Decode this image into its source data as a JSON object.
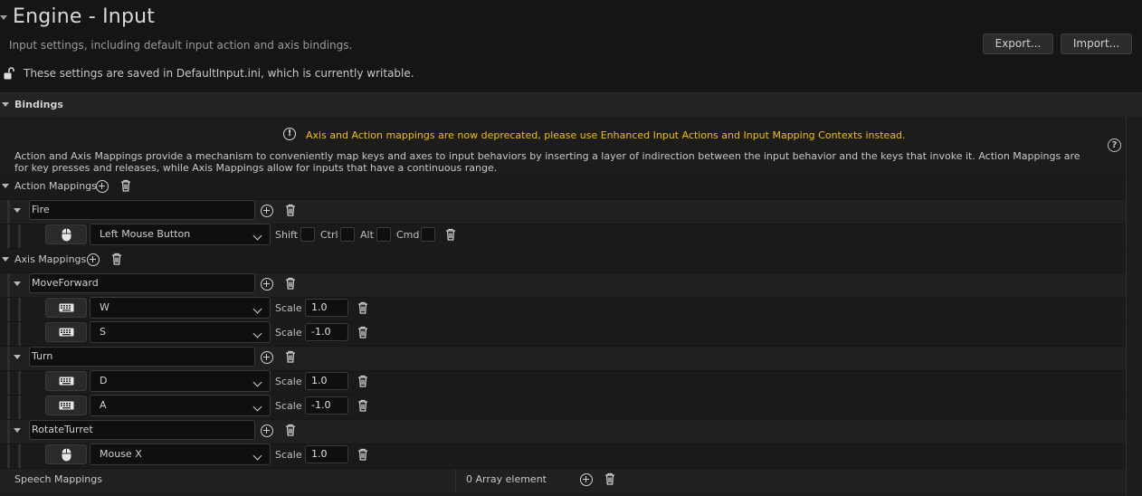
{
  "header": {
    "title": "Engine - Input",
    "subtitle": "Input settings, including default input action and axis bindings.",
    "export_label": "Export...",
    "import_label": "Import...",
    "saved_note": "These settings are saved in DefaultInput.ini, which is currently writable."
  },
  "bindings": {
    "section_label": "Bindings",
    "warning": "Axis and Action mappings are now deprecated, please use Enhanced Input Actions and Input Mapping Contexts instead.",
    "description": "Action and Axis Mappings provide a mechanism to conveniently map keys and axes to input behaviors by inserting a layer of indirection between the input behavior and the keys that invoke it. Action Mappings are for key presses and releases, while Axis Mappings allow for inputs that have a continuous range.",
    "warning_color": "#f0c000"
  },
  "action_mappings": {
    "label": "Action Mappings",
    "items": [
      {
        "name": "Fire",
        "key": "Left Mouse Button",
        "key_icon": "mouse-icon",
        "modifiers": {
          "shift": "Shift",
          "ctrl": "Ctrl",
          "alt": "Alt",
          "cmd": "Cmd"
        }
      }
    ]
  },
  "axis_mappings": {
    "label": "Axis Mappings",
    "scale_label": "Scale",
    "items": [
      {
        "name": "MoveForward",
        "keys": [
          {
            "key": "W",
            "scale": "1.0",
            "key_icon": "keyboard-icon"
          },
          {
            "key": "S",
            "scale": "-1.0",
            "key_icon": "keyboard-icon"
          }
        ]
      },
      {
        "name": "Turn",
        "keys": [
          {
            "key": "D",
            "scale": "1.0",
            "key_icon": "keyboard-icon"
          },
          {
            "key": "A",
            "scale": "-1.0",
            "key_icon": "keyboard-icon"
          }
        ]
      },
      {
        "name": "RotateTurret",
        "keys": [
          {
            "key": "Mouse X",
            "scale": "1.0",
            "key_icon": "mouse-icon"
          }
        ]
      }
    ]
  },
  "speech_mappings": {
    "label": "Speech Mappings",
    "count_text": "0 Array element"
  }
}
